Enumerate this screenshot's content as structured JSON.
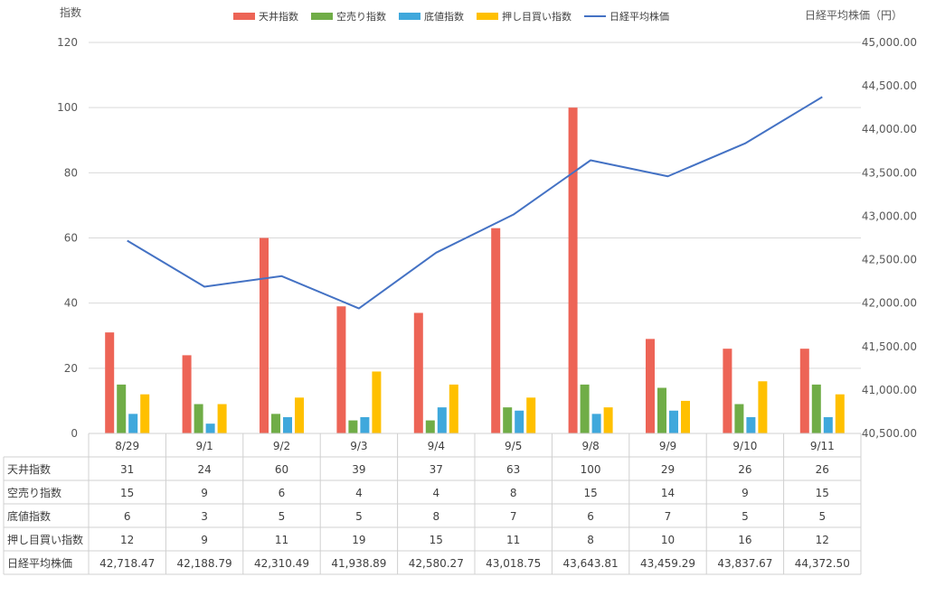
{
  "chart_data": {
    "type": "bar",
    "categories": [
      "8/29",
      "9/1",
      "9/2",
      "9/3",
      "9/4",
      "9/5",
      "9/8",
      "9/9",
      "9/10",
      "9/11"
    ],
    "y_left": {
      "title": "指数",
      "ylim": [
        0,
        120
      ],
      "ticks": [
        "0",
        "20",
        "40",
        "60",
        "80",
        "100",
        "120"
      ]
    },
    "y_right": {
      "title": "日経平均株価（円）",
      "ylim": [
        40500,
        45000
      ],
      "ticks": [
        "40,500.00",
        "41,000.00",
        "41,500.00",
        "42,000.00",
        "42,500.00",
        "43,000.00",
        "43,500.00",
        "44,000.00",
        "44,500.00",
        "45,000.00"
      ]
    },
    "legend_position": "top",
    "grid": true,
    "series": [
      {
        "name": "天井指数",
        "kind": "bar",
        "axis": "left",
        "color": "#ed6456",
        "values": [
          31,
          24,
          60,
          39,
          37,
          63,
          100,
          29,
          26,
          26
        ],
        "labels": [
          "31",
          "24",
          "60",
          "39",
          "37",
          "63",
          "100",
          "29",
          "26",
          "26"
        ]
      },
      {
        "name": "空売り指数",
        "kind": "bar",
        "axis": "left",
        "color": "#70ad47",
        "values": [
          15,
          9,
          6,
          4,
          4,
          8,
          15,
          14,
          9,
          15
        ],
        "labels": [
          "15",
          "9",
          "6",
          "4",
          "4",
          "8",
          "15",
          "14",
          "9",
          "15"
        ]
      },
      {
        "name": "底値指数",
        "kind": "bar",
        "axis": "left",
        "color": "#3fa8dc",
        "values": [
          6,
          3,
          5,
          5,
          8,
          7,
          6,
          7,
          5,
          5
        ],
        "labels": [
          "6",
          "3",
          "5",
          "5",
          "8",
          "7",
          "6",
          "7",
          "5",
          "5"
        ]
      },
      {
        "name": "押し目買い指数",
        "kind": "bar",
        "axis": "left",
        "color": "#ffc000",
        "values": [
          12,
          9,
          11,
          19,
          15,
          11,
          8,
          10,
          16,
          12
        ],
        "labels": [
          "12",
          "9",
          "11",
          "19",
          "15",
          "11",
          "8",
          "10",
          "16",
          "12"
        ]
      },
      {
        "name": "日経平均株価",
        "kind": "line",
        "axis": "right",
        "color": "#4472c4",
        "values": [
          42718.47,
          42188.79,
          42310.49,
          41938.89,
          42580.27,
          43018.75,
          43643.81,
          43459.29,
          43837.67,
          44372.5
        ],
        "labels": [
          "42,718.47",
          "42,188.79",
          "42,310.49",
          "41,938.89",
          "42,580.27",
          "43,018.75",
          "43,643.81",
          "43,459.29",
          "43,837.67",
          "44,372.50"
        ]
      }
    ]
  }
}
